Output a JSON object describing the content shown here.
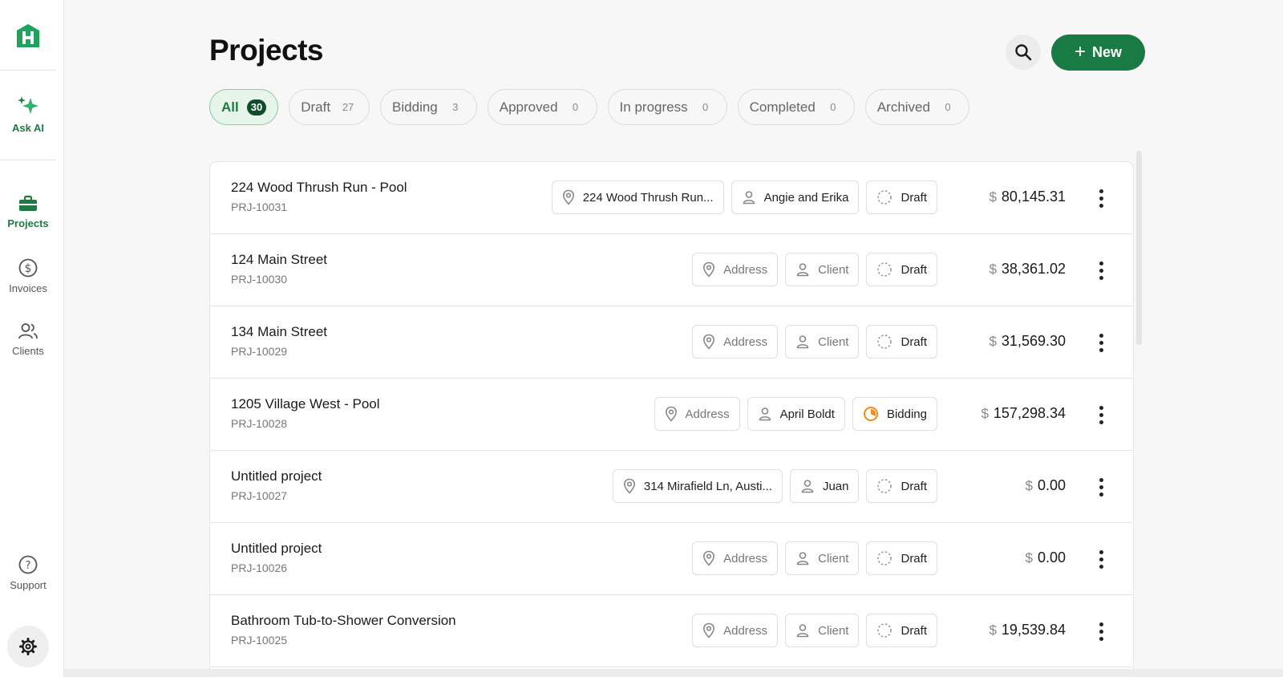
{
  "sidebar": {
    "ask_ai": "Ask AI",
    "items": [
      {
        "label": "Projects",
        "icon": "briefcase-icon",
        "active": true
      },
      {
        "label": "Invoices",
        "icon": "dollar-circle-icon",
        "active": false
      },
      {
        "label": "Clients",
        "icon": "users-icon",
        "active": false
      }
    ],
    "support": "Support",
    "brand_color": "#1fa35c"
  },
  "header": {
    "title": "Projects",
    "new_label": "New",
    "accent": "#1a7a44"
  },
  "tabs": [
    {
      "label": "All",
      "count": "30",
      "active": true
    },
    {
      "label": "Draft",
      "count": "27"
    },
    {
      "label": "Bidding",
      "count": "3"
    },
    {
      "label": "Approved",
      "count": "0"
    },
    {
      "label": "In progress",
      "count": "0"
    },
    {
      "label": "Completed",
      "count": "0"
    },
    {
      "label": "Archived",
      "count": "0"
    }
  ],
  "projects": [
    {
      "name": "224 Wood Thrush Run - Pool",
      "code": "PRJ-10031",
      "address": "224 Wood Thrush Run...",
      "client": "Angie and Erika",
      "status": "Draft",
      "currency": "$",
      "amount": "80,145.31"
    },
    {
      "name": "124 Main Street",
      "code": "PRJ-10030",
      "address": "Address",
      "client": "Client",
      "status": "Draft",
      "currency": "$",
      "amount": "38,361.02"
    },
    {
      "name": "134 Main Street",
      "code": "PRJ-10029",
      "address": "Address",
      "client": "Client",
      "status": "Draft",
      "currency": "$",
      "amount": "31,569.30"
    },
    {
      "name": "1205 Village West - Pool",
      "code": "PRJ-10028",
      "address": "Address",
      "client": "April Boldt",
      "status": "Bidding",
      "currency": "$",
      "amount": "157,298.34"
    },
    {
      "name": "Untitled project",
      "code": "PRJ-10027",
      "address": "314 Mirafield Ln, Austi...",
      "client": "Juan",
      "status": "Draft",
      "currency": "$",
      "amount": "0.00"
    },
    {
      "name": "Untitled project",
      "code": "PRJ-10026",
      "address": "Address",
      "client": "Client",
      "status": "Draft",
      "currency": "$",
      "amount": "0.00"
    },
    {
      "name": "Bathroom Tub-to-Shower Conversion",
      "code": "PRJ-10025",
      "address": "Address",
      "client": "Client",
      "status": "Draft",
      "currency": "$",
      "amount": "19,539.84"
    }
  ]
}
